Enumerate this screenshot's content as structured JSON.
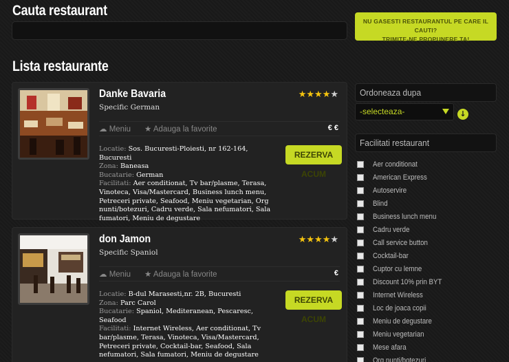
{
  "search": {
    "title": "Cauta restaurant",
    "propose_line1": "NU GASESTI RESTAURANTUL PE CARE IL CAUTI?",
    "propose_line2": "TRIMITE-NE PROPUNERE TA!"
  },
  "list": {
    "title": "Lista restaurante",
    "labels": {
      "menu": "Meniu",
      "favorite": "Adauga la favorite",
      "reserve": "REZERVA ACUM",
      "location": "Locatie:",
      "zone": "Zona:",
      "cuisine": "Bucatarie:",
      "facilities": "Facilitati:"
    },
    "restaurants": [
      {
        "name": "Danke Bavaria",
        "specific": "Specific German",
        "rating": 4,
        "rating_max": 5,
        "price": "€ €",
        "location": "Sos. Bucuresti-Ploiesti, nr 162-164, Bucuresti",
        "zone": "Baneasa",
        "cuisine": "German",
        "facilities": "Aer conditionat, Tv bar/plasme, Terasa, Vinoteca, Visa/Mastercard, Business lunch menu, Petreceri private, Seafood, Meniu vegetarian, Org nunti/botezuri, Cadru verde, Sala nefumatori, Sala fumatori, Meniu de degustare"
      },
      {
        "name": "don Jamon",
        "specific": "Specific Spaniol",
        "rating": 4,
        "rating_max": 5,
        "price": "€",
        "location": "B-dul Marasesti,nr. 2B, Bucuresti",
        "zone": "Parc Carol",
        "cuisine": "Spaniol, Mediteranean, Pescaresc, Seafood",
        "facilities": "Internet Wireless, Aer conditionat, Tv bar/plasme, Terasa, Vinoteca, Visa/Mastercard, Petreceri private, Cocktail-bar, Seafood, Sala nefumatori, Sala fumatori, Meniu de degustare"
      }
    ]
  },
  "sidebar": {
    "order_title": "Ordoneaza dupa",
    "select_value": "-selecteaza-",
    "facilities_title": "Facilitati restaurant",
    "facilities": [
      "Aer conditionat",
      "American Express",
      "Autoservire",
      "Blind",
      "Business lunch menu",
      "Cadru verde",
      "Call service button",
      "Cocktail-bar",
      "Cuptor cu lemne",
      "Discount 10% prin BYT",
      "Internet Wireless",
      "Loc de joaca copii",
      "Meniu de degustare",
      "Meniu vegetarian",
      "Mese afara",
      "Org nunti/botezuri"
    ]
  },
  "colors": {
    "accent": "#c6d924",
    "star": "#f5c40f",
    "background": "#1b1b1b"
  }
}
